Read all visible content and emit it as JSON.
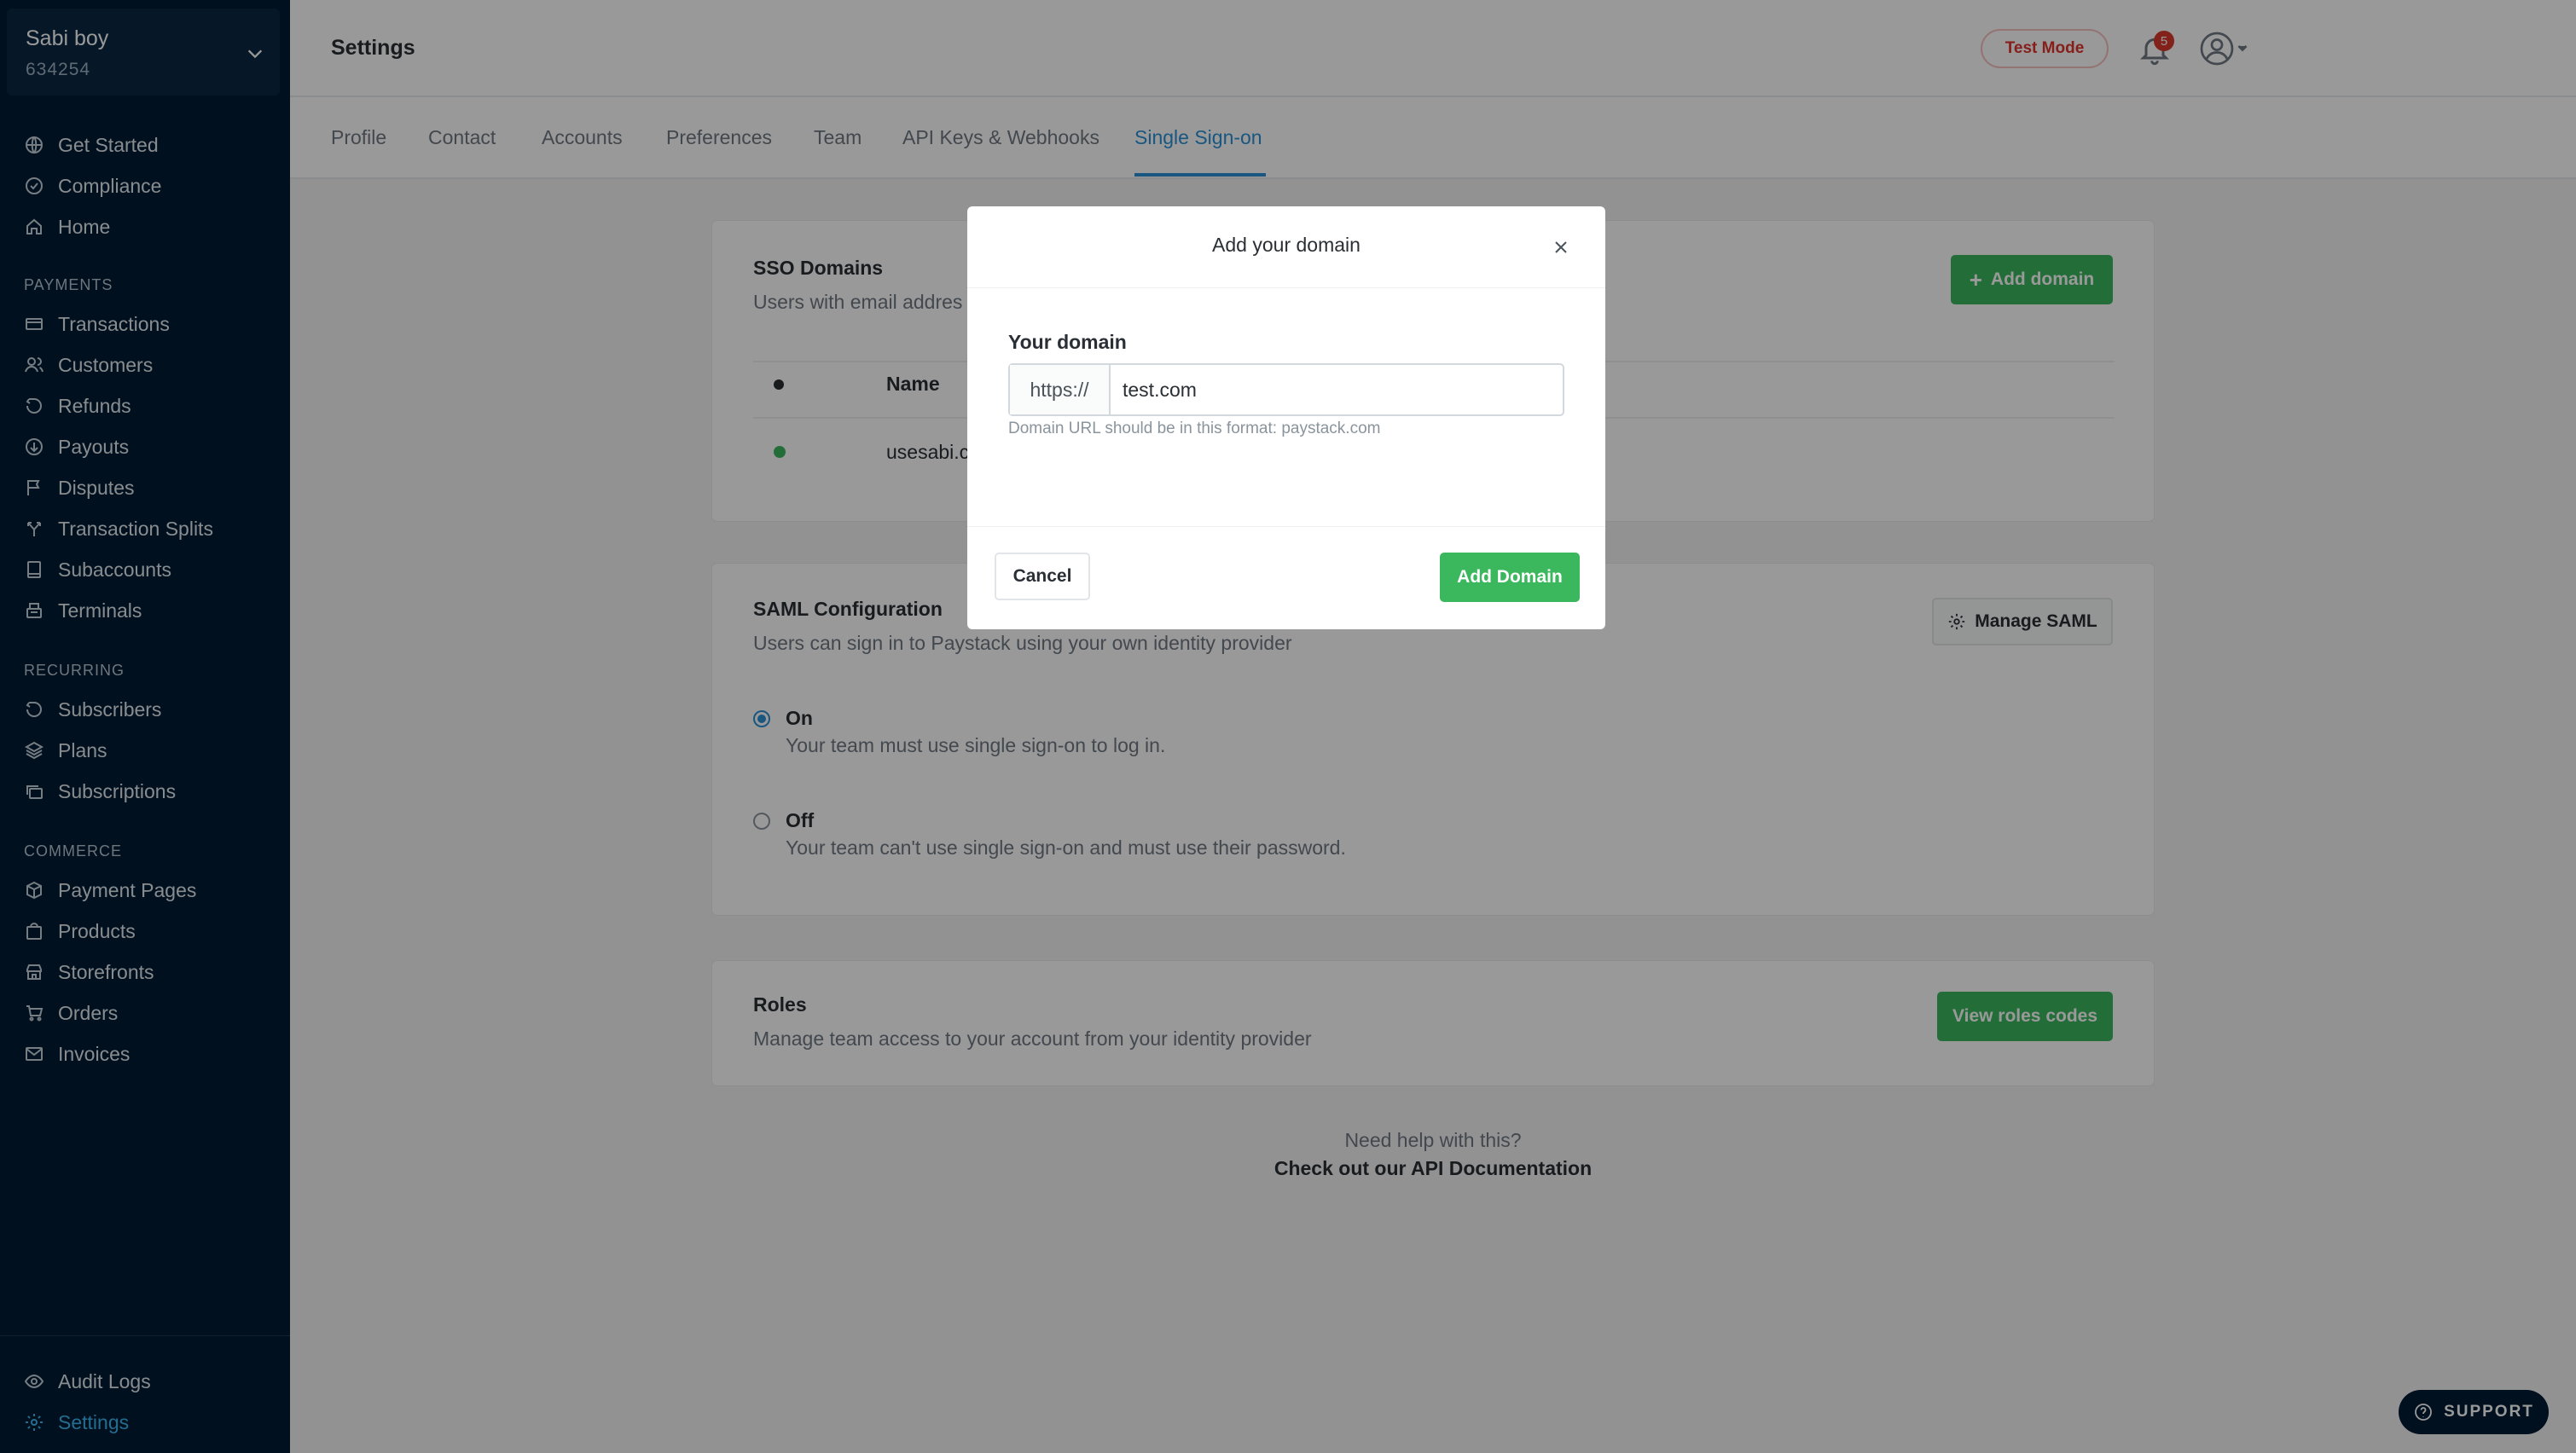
{
  "sidebar": {
    "business": {
      "name": "Sabi boy",
      "id": "634254"
    },
    "top_items": [
      {
        "label": "Get Started",
        "icon": "globe-icon"
      },
      {
        "label": "Compliance",
        "icon": "check-circle-icon"
      },
      {
        "label": "Home",
        "icon": "home-icon"
      }
    ],
    "sections": {
      "payments": "PAYMENTS",
      "recurring": "RECURRING",
      "commerce": "COMMERCE"
    },
    "payments_items": [
      {
        "label": "Transactions",
        "icon": "card-icon"
      },
      {
        "label": "Customers",
        "icon": "users-icon"
      },
      {
        "label": "Refunds",
        "icon": "refund-icon"
      },
      {
        "label": "Payouts",
        "icon": "payout-icon"
      },
      {
        "label": "Disputes",
        "icon": "flag-icon"
      },
      {
        "label": "Transaction Splits",
        "icon": "split-icon"
      },
      {
        "label": "Subaccounts",
        "icon": "book-icon"
      },
      {
        "label": "Terminals",
        "icon": "terminal-icon"
      }
    ],
    "recurring_items": [
      {
        "label": "Subscribers",
        "icon": "refresh-icon"
      },
      {
        "label": "Plans",
        "icon": "layers-icon"
      },
      {
        "label": "Subscriptions",
        "icon": "stack-icon"
      }
    ],
    "commerce_items": [
      {
        "label": "Payment Pages",
        "icon": "box-icon"
      },
      {
        "label": "Products",
        "icon": "bag-icon"
      },
      {
        "label": "Storefronts",
        "icon": "store-icon"
      },
      {
        "label": "Orders",
        "icon": "cart-icon"
      },
      {
        "label": "Invoices",
        "icon": "mail-icon"
      }
    ],
    "bottom_items": [
      {
        "label": "Audit Logs",
        "icon": "eye-icon"
      },
      {
        "label": "Settings",
        "icon": "gear-icon"
      }
    ]
  },
  "header": {
    "title": "Settings",
    "test_mode": "Test Mode",
    "notification_count": "5"
  },
  "tabs": [
    "Profile",
    "Contact",
    "Accounts",
    "Preferences",
    "Team",
    "API Keys & Webhooks",
    "Single Sign-on"
  ],
  "sso_domains": {
    "title": "SSO Domains",
    "subtitle": "Users with email addres",
    "add_button": "Add domain",
    "col_name": "Name",
    "row_name": "usesabi.c"
  },
  "saml": {
    "title": "SAML Configuration",
    "subtitle": "Users can sign in to Paystack using your own identity provider",
    "manage_button": "Manage SAML",
    "on_label": "On",
    "on_desc": "Your team must use single sign-on to log in.",
    "off_label": "Off",
    "off_desc": "Your team can't use single sign-on and must use their password."
  },
  "roles": {
    "title": "Roles",
    "subtitle": "Manage team access to your account from your identity provider",
    "button": "View roles codes"
  },
  "help": {
    "line1": "Need help with this?",
    "line2": "Check out our API Documentation"
  },
  "support": "SUPPORT",
  "modal": {
    "title": "Add your domain",
    "field_label": "Your domain",
    "prefix": "https://",
    "value": "test.com",
    "hint": "Domain URL should be in this format: paystack.com",
    "cancel": "Cancel",
    "submit": "Add Domain"
  },
  "colors": {
    "sidebar_bg": "#011b33",
    "accent_blue": "#2b8fd6",
    "green": "#3bb75e",
    "test_mode_red": "#e0342d"
  }
}
